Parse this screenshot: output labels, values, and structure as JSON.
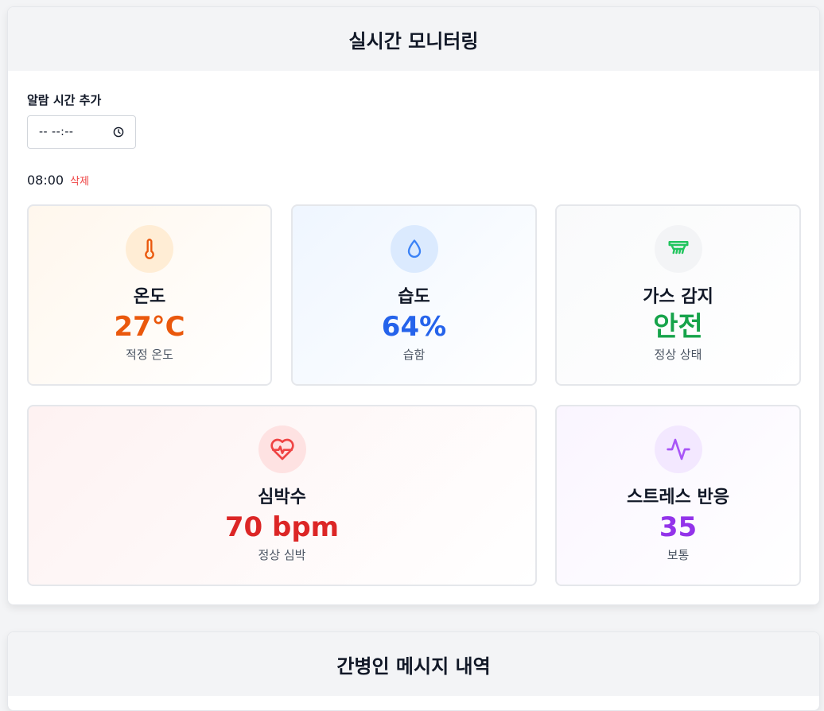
{
  "monitor": {
    "title": "실시간 모니터링",
    "alarm": {
      "label": "알람 시간 추가",
      "input_placeholder": "-- --:--",
      "entries": [
        {
          "time": "08:00",
          "delete_label": "삭제"
        }
      ]
    },
    "cards": {
      "temperature": {
        "title": "온도",
        "value": "27°C",
        "status": "적정 온도",
        "icon": "thermometer-icon",
        "color": "#ea580c"
      },
      "humidity": {
        "title": "습도",
        "value": "64%",
        "status": "습함",
        "icon": "droplet-icon",
        "color": "#2563eb"
      },
      "gas": {
        "title": "가스 감지",
        "value": "안전",
        "status": "정상 상태",
        "icon": "gas-detector-icon",
        "color": "#16a34a"
      },
      "heart_rate": {
        "title": "심박수",
        "value": "70 bpm",
        "status": "정상 심박",
        "icon": "heart-pulse-icon",
        "color": "#dc2626"
      },
      "stress": {
        "title": "스트레스 반응",
        "value": "35",
        "status": "보통",
        "icon": "activity-icon",
        "color": "#9333ea"
      }
    }
  },
  "messages": {
    "title": "간병인 메시지 내역"
  }
}
